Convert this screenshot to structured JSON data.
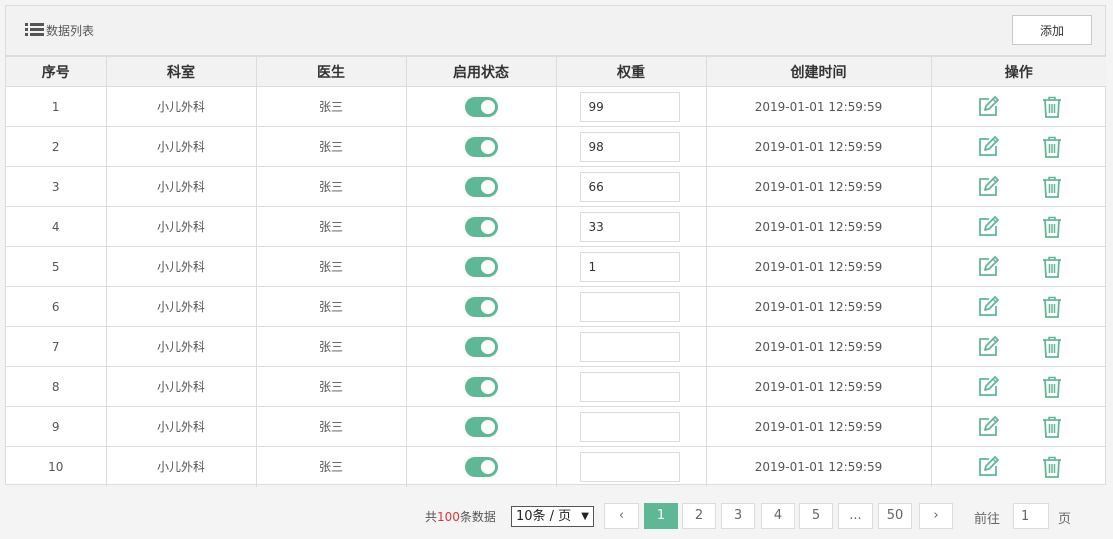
{
  "header": {
    "title": "数据列表",
    "add_label": "添加"
  },
  "table": {
    "columns": [
      "序号",
      "科室",
      "医生",
      "启用状态",
      "权重",
      "创建时间",
      "操作"
    ],
    "rows": [
      {
        "index": "1",
        "dept": "小儿外科",
        "doctor": "张三",
        "enabled": true,
        "weight": "99",
        "created": "2019-01-01 12:59:59"
      },
      {
        "index": "2",
        "dept": "小儿外科",
        "doctor": "张三",
        "enabled": true,
        "weight": "98",
        "created": "2019-01-01 12:59:59"
      },
      {
        "index": "3",
        "dept": "小儿外科",
        "doctor": "张三",
        "enabled": true,
        "weight": "66",
        "created": "2019-01-01 12:59:59"
      },
      {
        "index": "4",
        "dept": "小儿外科",
        "doctor": "张三",
        "enabled": true,
        "weight": "33",
        "created": "2019-01-01 12:59:59"
      },
      {
        "index": "5",
        "dept": "小儿外科",
        "doctor": "张三",
        "enabled": true,
        "weight": "1",
        "created": "2019-01-01 12:59:59"
      },
      {
        "index": "6",
        "dept": "小儿外科",
        "doctor": "张三",
        "enabled": true,
        "weight": "",
        "created": "2019-01-01 12:59:59"
      },
      {
        "index": "7",
        "dept": "小儿外科",
        "doctor": "张三",
        "enabled": true,
        "weight": "",
        "created": "2019-01-01 12:59:59"
      },
      {
        "index": "8",
        "dept": "小儿外科",
        "doctor": "张三",
        "enabled": true,
        "weight": "",
        "created": "2019-01-01 12:59:59"
      },
      {
        "index": "9",
        "dept": "小儿外科",
        "doctor": "张三",
        "enabled": true,
        "weight": "",
        "created": "2019-01-01 12:59:59"
      },
      {
        "index": "10",
        "dept": "小儿外科",
        "doctor": "张三",
        "enabled": true,
        "weight": "",
        "created": "2019-01-01 12:59:59"
      }
    ]
  },
  "pagination": {
    "total_prefix": "共",
    "total_count": "100",
    "total_suffix": "条数据",
    "page_size_label": "10条 / 页",
    "prev_label": "‹",
    "pages": [
      "1",
      "2",
      "3",
      "4",
      "5",
      "...",
      "50"
    ],
    "current_page": "1",
    "next_label": "›",
    "goto_label": "前往",
    "goto_value": "1",
    "page_unit": "页"
  },
  "colors": {
    "accent": "#5fb895",
    "total_highlight": "#e2333c",
    "header_bg": "#f2f2f2",
    "border": "#dcdcdc"
  },
  "icons": {
    "header": "list-icon",
    "edit": "edit-icon",
    "delete": "trash-icon",
    "size_select": "caret-down-icon"
  }
}
